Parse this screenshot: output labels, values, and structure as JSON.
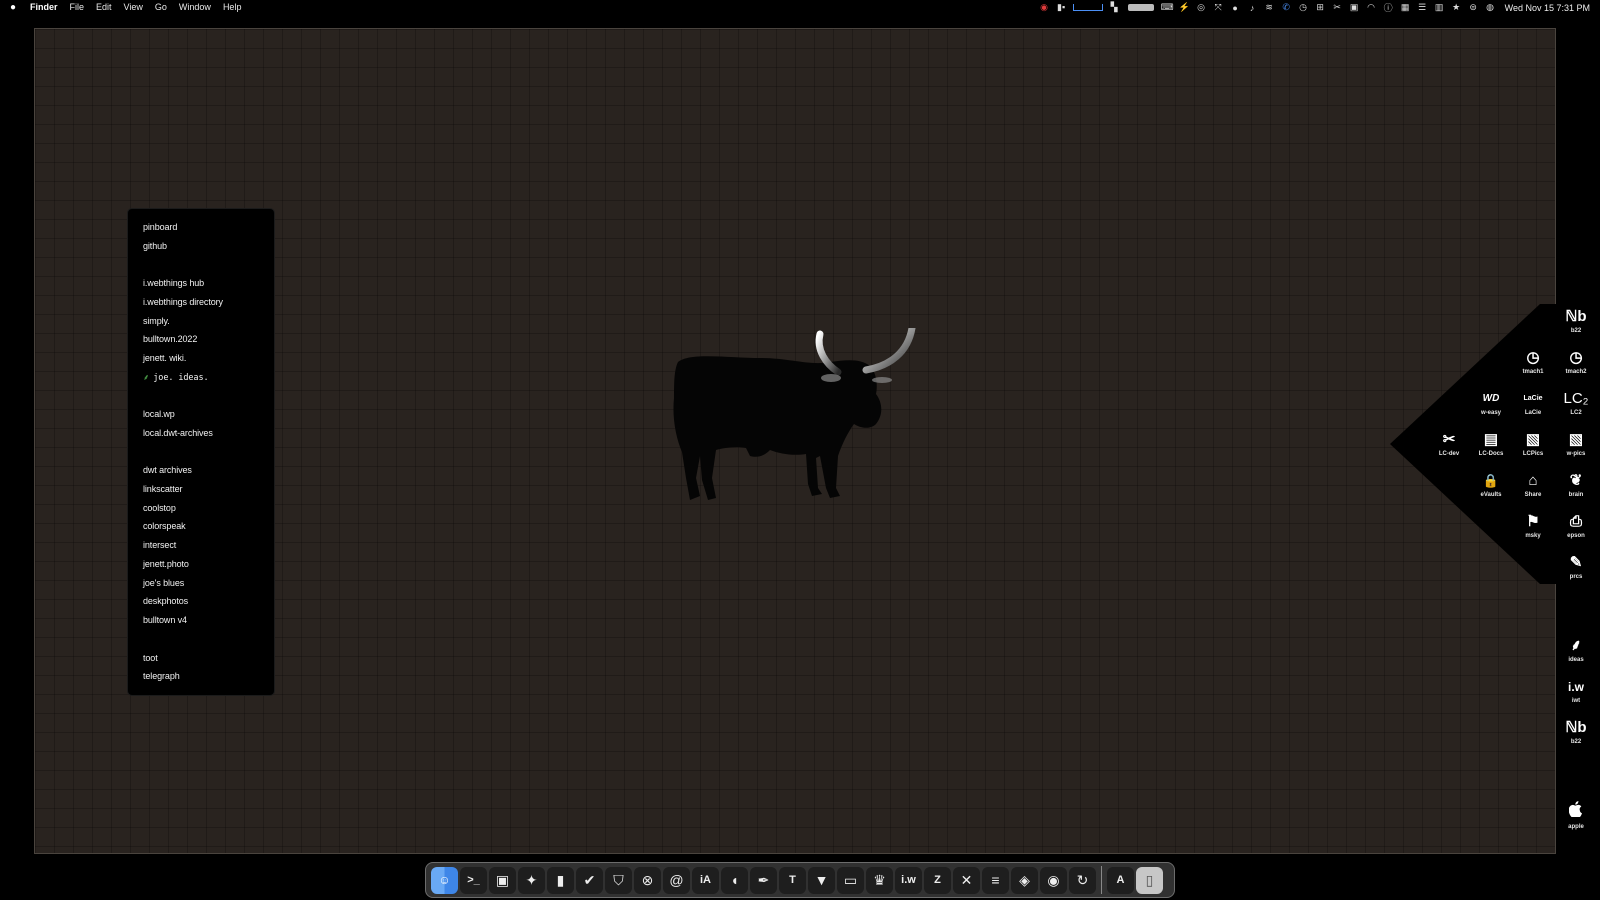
{
  "menubar": {
    "apple": "",
    "items": [
      "Finder",
      "File",
      "Edit",
      "View",
      "Go",
      "Window",
      "Help"
    ],
    "clock": "Wed Nov 15  7:31 PM"
  },
  "bookmarks": [
    {
      "label": "pinboard"
    },
    {
      "label": "github"
    },
    {
      "label": "i.webthings hub"
    },
    {
      "label": "i.webthings directory"
    },
    {
      "label": "simply."
    },
    {
      "label": "bulltown.2022"
    },
    {
      "label": "jenett. wiki."
    },
    {
      "label": "joe. ideas.",
      "icon": "sprout-icon",
      "mono": true
    },
    {
      "label": "local.wp"
    },
    {
      "label": "local.dwt-archives"
    },
    {
      "label": "dwt archives"
    },
    {
      "label": "linkscatter"
    },
    {
      "label": "coolstop"
    },
    {
      "label": "colorspeak"
    },
    {
      "label": "intersect"
    },
    {
      "label": "jenett.photo"
    },
    {
      "label": "joe's blues"
    },
    {
      "label": "deskphotos"
    },
    {
      "label": "bulltown v4"
    },
    {
      "label": "toot"
    },
    {
      "label": "telegraph"
    }
  ],
  "launcher": [
    {
      "label": "b22",
      "icon": "b22-logo-icon",
      "glyph": "ℕb"
    },
    {
      "label": "tmach1",
      "icon": "clock-history-icon",
      "glyph": "◷"
    },
    {
      "label": "tmach2",
      "icon": "clock-history-icon",
      "glyph": "◷"
    },
    {
      "label": "w-easy",
      "icon": "wd-drive-icon",
      "glyph": "WD"
    },
    {
      "label": "LaCie",
      "icon": "lacie-logo-icon",
      "glyph": "LaCie"
    },
    {
      "label": "LC2",
      "icon": "lc2-icon",
      "glyph": "LC₂"
    },
    {
      "label": "LC-dev",
      "icon": "tools-icon",
      "glyph": "✂"
    },
    {
      "label": "LC-Docs",
      "icon": "document-icon",
      "glyph": "▤"
    },
    {
      "label": "LCPics",
      "icon": "photos-icon",
      "glyph": "▧"
    },
    {
      "label": "w-pics",
      "icon": "photos-icon",
      "glyph": "▧"
    },
    {
      "label": "eVaults",
      "icon": "lock-icon",
      "glyph": "🔒"
    },
    {
      "label": "Share",
      "icon": "home-icon",
      "glyph": "⌂"
    },
    {
      "label": "brain",
      "icon": "brain-icon",
      "glyph": "❦"
    },
    {
      "label": "msky",
      "icon": "flag-icon",
      "glyph": "⚑"
    },
    {
      "label": "epson",
      "icon": "printer-icon",
      "glyph": "⎙"
    },
    {
      "label": "prcs",
      "icon": "pencil-icon",
      "glyph": "✎"
    },
    {
      "label": "ideas",
      "icon": "sprout-icon",
      "glyph": "⸙"
    },
    {
      "label": "iwt",
      "icon": "iw-logo-icon",
      "glyph": "i.w"
    },
    {
      "label": "b22",
      "icon": "b22-logo-icon",
      "glyph": "ℕb"
    },
    {
      "label": "apple",
      "icon": "apple-logo-icon",
      "glyph": ""
    }
  ],
  "dock": [
    {
      "name": "finder",
      "glyph": "☺"
    },
    {
      "name": "terminal",
      "glyph": ">_"
    },
    {
      "name": "preview",
      "glyph": "▣"
    },
    {
      "name": "feather-app",
      "glyph": "✦"
    },
    {
      "name": "bookmark-app",
      "glyph": "▮"
    },
    {
      "name": "tasks",
      "glyph": "✔"
    },
    {
      "name": "shield-app",
      "glyph": "⛉"
    },
    {
      "name": "xcode-circle",
      "glyph": "⊗"
    },
    {
      "name": "spiral-app",
      "glyph": "@"
    },
    {
      "name": "ia-writer",
      "glyph": "iA"
    },
    {
      "name": "leaf-app",
      "glyph": "◖"
    },
    {
      "name": "pen-app",
      "glyph": "✒"
    },
    {
      "name": "typora",
      "glyph": "T"
    },
    {
      "name": "bookmarks",
      "glyph": "▼"
    },
    {
      "name": "folder-app",
      "glyph": "▭"
    },
    {
      "name": "crown-app",
      "glyph": "♛"
    },
    {
      "name": "iwebthings",
      "glyph": "i.w"
    },
    {
      "name": "filezilla",
      "glyph": "Z"
    },
    {
      "name": "x-app",
      "glyph": "✕"
    },
    {
      "name": "list-app",
      "glyph": "≡"
    },
    {
      "name": "diamond-app",
      "glyph": "◈"
    },
    {
      "name": "github",
      "glyph": "◉"
    },
    {
      "name": "sync-app",
      "glyph": "↻"
    },
    {
      "name": "app-store",
      "glyph": "A",
      "sep_before": true
    },
    {
      "name": "trash",
      "glyph": "▯"
    }
  ]
}
